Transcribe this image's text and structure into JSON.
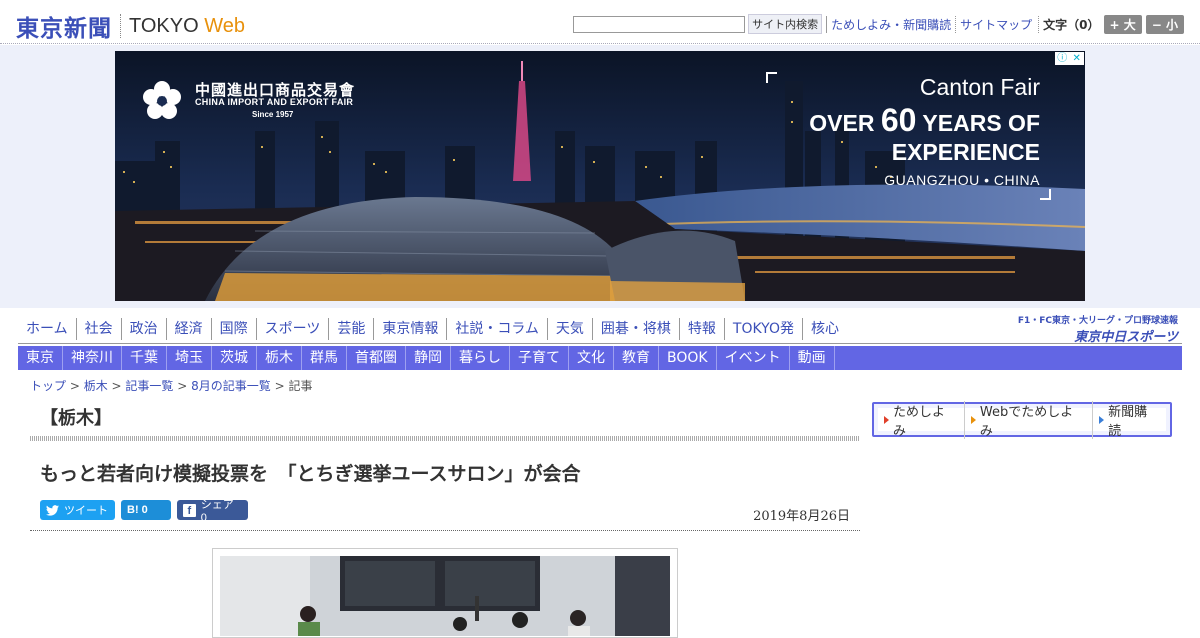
{
  "header": {
    "logo_jp": "東京新聞",
    "logo_en_a": "TOKYO ",
    "logo_en_b": "Web",
    "search_button": "サイト内検索",
    "link_trial": "ためしよみ・新聞購読",
    "link_sitemap": "サイトマップ",
    "font_size_label": "文字（0）",
    "font_bigger": "+ 大",
    "font_smaller": "− 小"
  },
  "ad": {
    "org_cn": "中國進出口商品交易會",
    "org_en": "CHINA IMPORT AND EXPORT FAIR",
    "since": "Since 1957",
    "line1": "Canton Fair",
    "line2_a": "OVER ",
    "line2_num": "60",
    "line2_b": " YEARS OF",
    "line3": "EXPERIENCE",
    "line4": "GUANGZHOU • CHINA",
    "info_icon": "ⓘ",
    "close_icon": "✕"
  },
  "nav_main": [
    "ホーム",
    "社会",
    "政治",
    "経済",
    "国際",
    "スポーツ",
    "芸能",
    "東京情報",
    "社説・コラム",
    "天気",
    "囲碁・将棋",
    "特報",
    "TOKYO発",
    "核心"
  ],
  "nav_region": [
    "東京",
    "神奈川",
    "千葉",
    "埼玉",
    "茨城",
    "栃木",
    "群馬",
    "首都圏",
    "静岡",
    "暮らし",
    "子育て",
    "文化",
    "教育",
    "BOOK",
    "イベント",
    "動画"
  ],
  "chunichi": {
    "line1": "F1・FC東京・大リーグ・プロ野球速報",
    "line2": "東京中日スポーツ"
  },
  "breadcrumb": {
    "top": "トップ",
    "region": "栃木",
    "list": "記事一覧",
    "month": "8月の記事一覧",
    "current": "記事",
    "sep": " > "
  },
  "article": {
    "section": "【栃木】",
    "title": "もっと若者向け模擬投票を　「とちぎ選挙ユースサロン」が会合",
    "date": "2019年8月26日"
  },
  "share": {
    "tweet": "ツイート",
    "hatena": "B!  0",
    "facebook": "シェア 0"
  },
  "side": {
    "trial": "ためしよみ",
    "web_trial": "Webでためしよみ",
    "subscribe": "新聞購読"
  }
}
